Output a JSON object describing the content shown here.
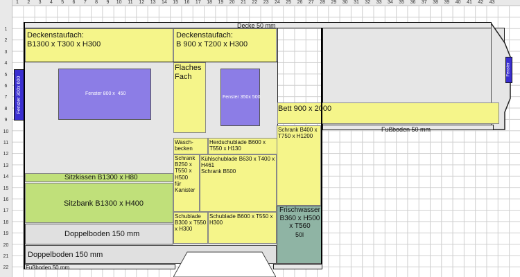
{
  "columns": [
    "1",
    "2",
    "3",
    "4",
    "5",
    "6",
    "7",
    "8",
    "9",
    "10",
    "11",
    "12",
    "13",
    "14",
    "15",
    "16",
    "17",
    "18",
    "19",
    "20",
    "21",
    "22",
    "23",
    "24",
    "25",
    "26",
    "27",
    "28",
    "29",
    "30",
    "31",
    "32",
    "33",
    "34",
    "35",
    "36",
    "37",
    "38",
    "39",
    "40",
    "41",
    "42",
    "43"
  ],
  "rows": [
    "1",
    "2",
    "3",
    "4",
    "5",
    "6",
    "7",
    "8",
    "9",
    "10",
    "11",
    "12",
    "13",
    "14",
    "15",
    "16",
    "17",
    "18",
    "19",
    "20",
    "21",
    "22"
  ],
  "labels": {
    "decke": "Decke 50 mm",
    "deckenstaufach1": "Deckenstaufach:\nB1300 x T300 x H300",
    "deckenstaufach2": "Deckenstaufach:\nB 900 x T200 x H300",
    "fenster_800": "Fenster 800 x  450",
    "fenster_350": "Fenster 350x 500",
    "fenster_left": "Fenster 300x 600",
    "fenster_right": "Fenster",
    "flaches_fach": "Flaches\nFach",
    "bett": "Bett 900 x 2000",
    "fussboden_right": "Fußboden 50 mm",
    "schrank_b400": "Schrank B400 x\nT750 x H1200",
    "waschbecken": "Wasch-\nbecken",
    "herdschublade": "Herdschublade B600 x\nT550 x H130",
    "schrank_b250": "Schrank\nB250 x\nT550 x\nH500\nfür\nKanister",
    "kuehlschublade": "Kühlschublade B630 x T400 x\nH461\nSchrank B500",
    "sitzkissen": "Sitzkissen B1300 x H80",
    "sitzbank": "Sitzbank B1300 x H400",
    "frischwasser": "Frischwasser\nB360 x H500\nx T560",
    "frischwasser_vol": "50l",
    "schublade_b300": "Schublade\nB300 x T550\nx H300",
    "schublade_b600": "Schublade B600 x T550 x\nH300",
    "doppelboden1": "Doppelboden 150 mm",
    "doppelboden2": "Doppelboden 150 mm",
    "fussboden_left": "Fußboden 50 mm"
  },
  "colors": {
    "yellow": "#f5f58a",
    "green": "#c0e07a",
    "purple": "#8c7de6",
    "teal": "#8fb4a4",
    "grey": "#e6e6e6",
    "navy": "#3a2fd0"
  }
}
